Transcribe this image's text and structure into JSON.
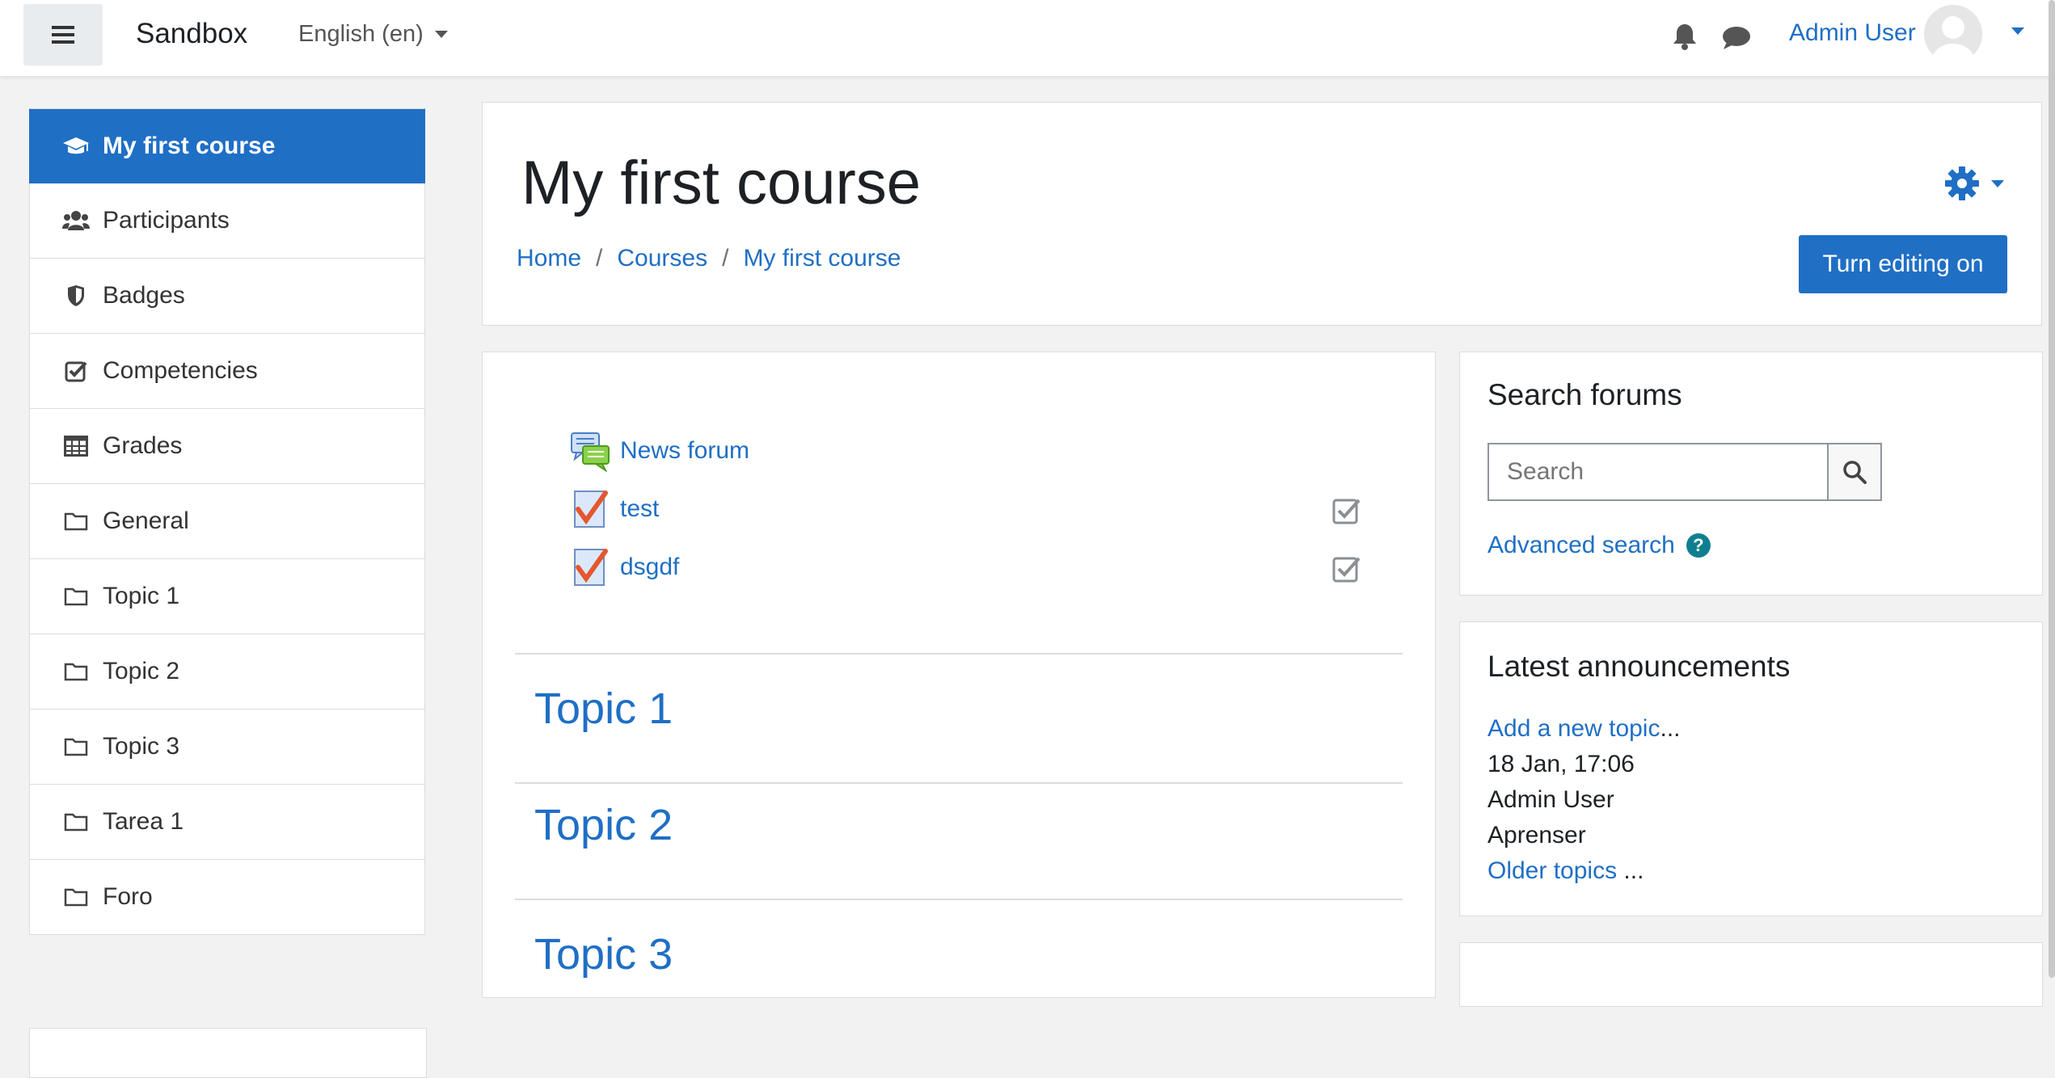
{
  "navbar": {
    "site_name": "Sandbox",
    "language": "English (en)",
    "user_name": "Admin User",
    "icons": [
      "menu-icon",
      "bell-icon",
      "chat-icon",
      "avatar",
      "chevron-down-icon"
    ]
  },
  "drawer": {
    "items": [
      {
        "label": "My first course",
        "icon": "graduation-cap-icon",
        "active": true
      },
      {
        "label": "Participants",
        "icon": "users-icon"
      },
      {
        "label": "Badges",
        "icon": "shield-icon"
      },
      {
        "label": "Competencies",
        "icon": "check-square-icon"
      },
      {
        "label": "Grades",
        "icon": "table-icon"
      },
      {
        "label": "General",
        "icon": "folder-icon"
      },
      {
        "label": "Topic 1",
        "icon": "folder-icon"
      },
      {
        "label": "Topic 2",
        "icon": "folder-icon"
      },
      {
        "label": "Topic 3",
        "icon": "folder-icon"
      },
      {
        "label": "Tarea 1",
        "icon": "folder-icon"
      },
      {
        "label": "Foro",
        "icon": "folder-icon"
      }
    ]
  },
  "header": {
    "title": "My first course",
    "breadcrumb": [
      "Home",
      "Courses",
      "My first course"
    ],
    "breadcrumb_separator": "/",
    "edit_button": "Turn editing on"
  },
  "course": {
    "activities": [
      {
        "label": "News forum",
        "icon": "forum-icon"
      },
      {
        "label": "test",
        "icon": "assignment-icon"
      },
      {
        "label": "dsgdf",
        "icon": "assignment-icon"
      }
    ],
    "topics": [
      "Topic 1",
      "Topic 2",
      "Topic 3"
    ]
  },
  "search_forums": {
    "title": "Search forums",
    "placeholder": "Search",
    "advanced_search": "Advanced search"
  },
  "announcements": {
    "title": "Latest announcements",
    "add_topic": "Add a new topic",
    "ellipsis": "...",
    "date": "18 Jan, 17:06",
    "author": "Admin User",
    "post_title": "Aprenser",
    "older_topics": "Older topics",
    "older_ellipsis": " ..."
  },
  "colors": {
    "accent": "#1f6fc5",
    "help_icon": "#0f7f8f",
    "background": "#f2f2f2"
  }
}
